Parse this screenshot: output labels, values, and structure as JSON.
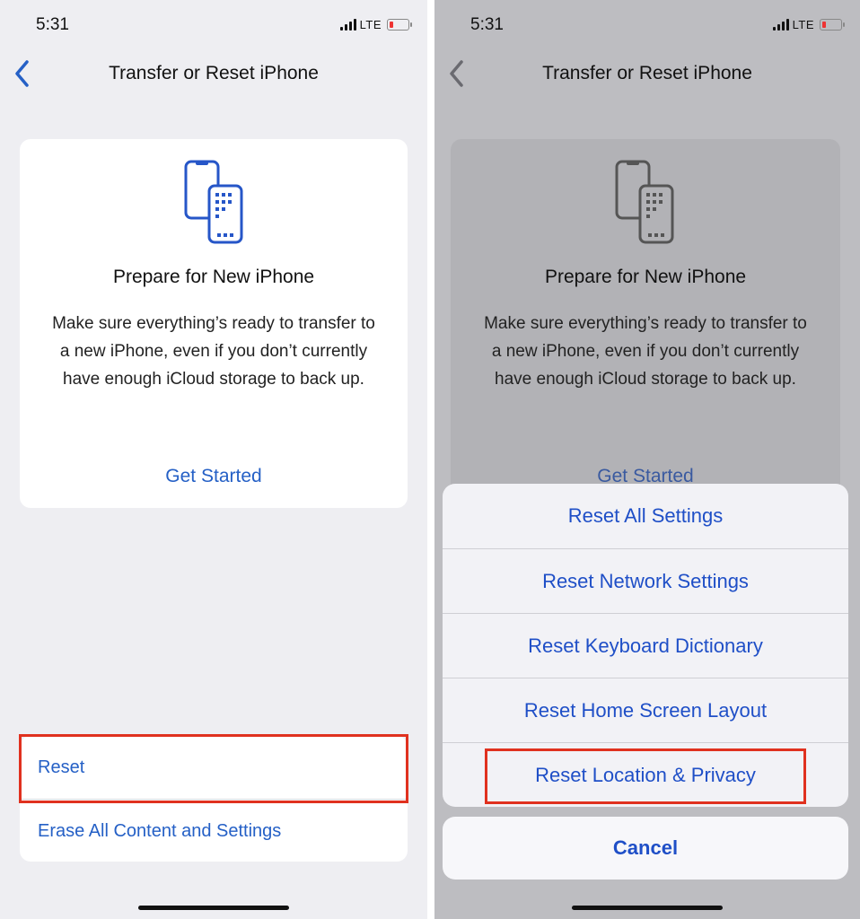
{
  "colors": {
    "accent": "#2560c6",
    "highlight": "#e0311f",
    "background": "#eeeef2",
    "dimmed_background": "#bdbdc1"
  },
  "left_screen": {
    "status_bar": {
      "time": "5:31",
      "network": "LTE"
    },
    "nav": {
      "back_icon": "chevron-left-icon",
      "title": "Transfer or Reset iPhone"
    },
    "prepare_card": {
      "icon": "two-iphones-icon",
      "title": "Prepare for New iPhone",
      "description": "Make sure everything’s ready to transfer to a new iPhone, even if you don’t currently have enough iCloud storage to back up.",
      "link": "Get Started"
    },
    "options": {
      "reset": "Reset",
      "erase": "Erase All Content and Settings"
    }
  },
  "right_screen": {
    "status_bar": {
      "time": "5:31",
      "network": "LTE"
    },
    "nav": {
      "back_icon": "chevron-left-icon",
      "title": "Transfer or Reset iPhone"
    },
    "prepare_card": {
      "icon": "two-iphones-icon",
      "title": "Prepare for New iPhone",
      "description": "Make sure everything’s ready to transfer to a new iPhone, even if you don’t currently have enough iCloud storage to back up.",
      "link": "Get Started"
    },
    "action_sheet": {
      "items": [
        {
          "label": "Reset All Settings"
        },
        {
          "label": "Reset Network Settings"
        },
        {
          "label": "Reset Keyboard Dictionary"
        },
        {
          "label": "Reset Home Screen Layout"
        },
        {
          "label": "Reset Location & Privacy"
        }
      ],
      "cancel": "Cancel"
    }
  }
}
